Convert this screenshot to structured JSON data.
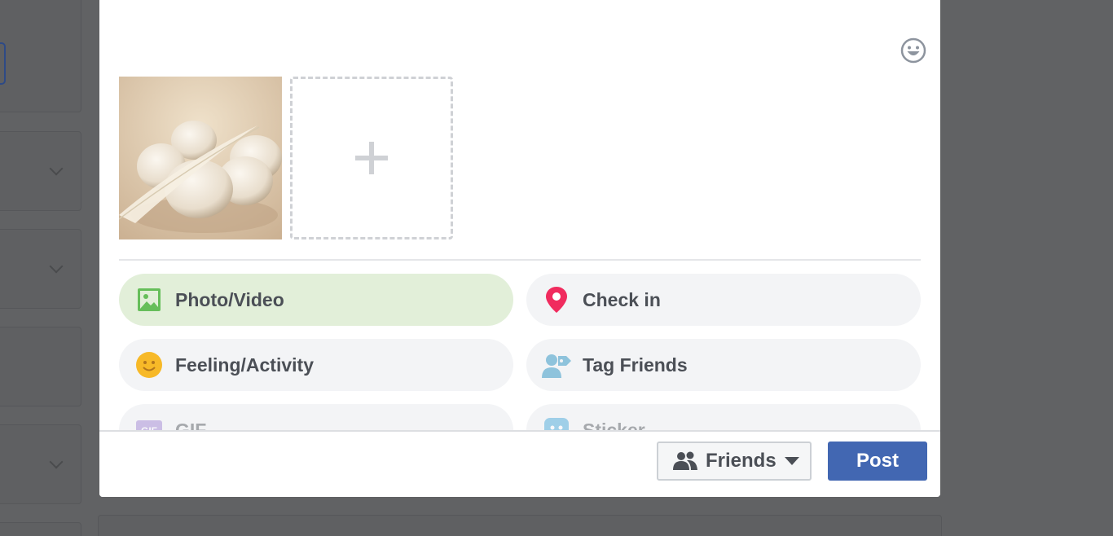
{
  "composer": {
    "emoji_icon": "smiley-face-icon",
    "attachments": [
      {
        "type": "photo",
        "subject": "eggs-with-feather"
      }
    ],
    "add_icon": "plus-icon",
    "options": [
      {
        "label": "Photo/Video",
        "icon": "photo-icon",
        "color": "#66be5a",
        "active": true
      },
      {
        "label": "Check in",
        "icon": "location-pin-icon",
        "color": "#f02b5e"
      },
      {
        "label": "Feeling/Activity",
        "icon": "smiley-icon",
        "color": "#f7b928"
      },
      {
        "label": "Tag Friends",
        "icon": "tag-person-icon",
        "color": "#8ec3dc"
      },
      {
        "label": "GIF",
        "icon": "gif-icon",
        "color": "#9c7fd1"
      },
      {
        "label": "Sticker",
        "icon": "sticker-icon",
        "color": "#3aa3d8"
      }
    ],
    "footer": {
      "audience_label": "Friends",
      "audience_icon": "friends-icon",
      "post_label": "Post",
      "post_color": "#4267b2"
    }
  }
}
